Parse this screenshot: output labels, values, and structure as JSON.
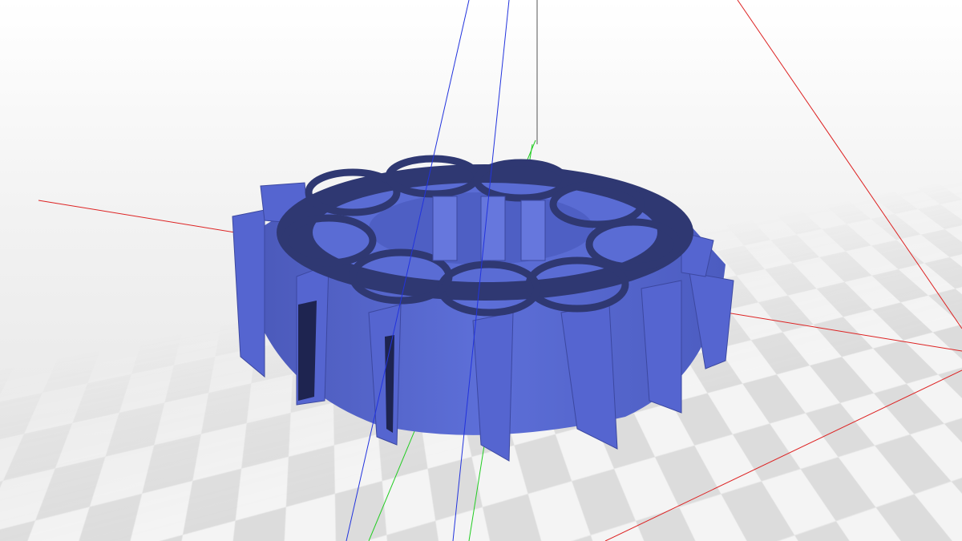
{
  "viewport": {
    "model_icon": "gear-flower-3d-model",
    "colors": {
      "model": "#5566cc",
      "model_dark": "#2e3670",
      "axis_x": "#dd2222",
      "axis_y": "#22cc22",
      "axis_z": "#2233dd",
      "floor_light": "#f4f4f4",
      "floor_dark": "#dcdcdc"
    }
  }
}
